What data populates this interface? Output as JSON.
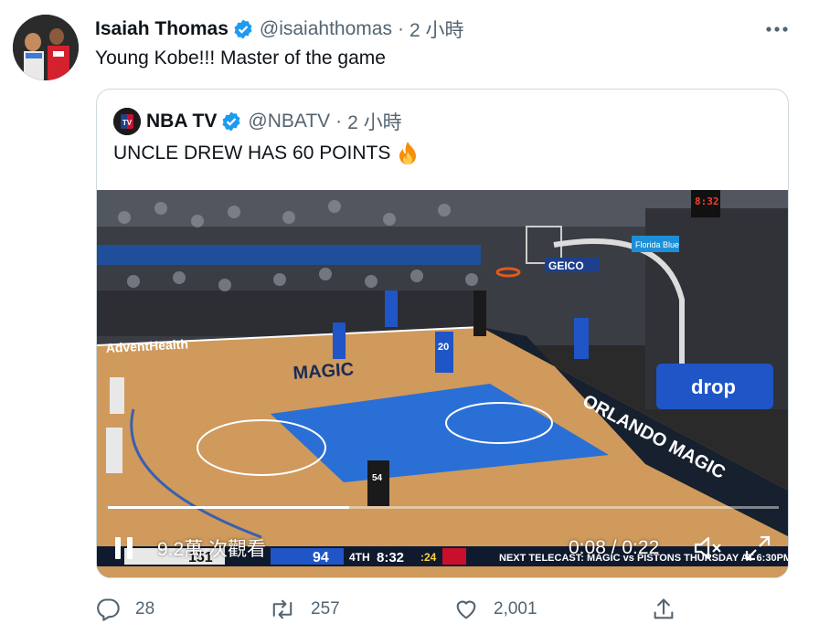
{
  "tweet": {
    "author_name": "Isaiah Thomas",
    "author_handle": "@isaiahthomas",
    "separator": "·",
    "time": "2 小時",
    "text": "Young Kobe!!! Master of the game"
  },
  "quoted": {
    "author_name": "NBA TV",
    "author_handle": "@NBATV",
    "separator": "·",
    "time": "2 小時",
    "text": "UNCLE DREW HAS 60 POINTS",
    "video": {
      "views": "9.2萬 次觀看",
      "timestamp": "0:08 / 0:22",
      "progress": 0.36,
      "scoreboard": {
        "away_score": "151",
        "home_score": "94",
        "quarter": "4TH",
        "clock": "8:32",
        "shot_clock": ":24",
        "ticker": "NEXT TELECAST: MAGIC vs PISTONS  THURSDAY AT 6:30PM"
      },
      "arena_text": {
        "baseline": "ORLANDO MAGIC",
        "sideline": "AdventHealth",
        "floor_logo": "MAGIC",
        "sponsor": "GEICO",
        "sign": "Florida Blue",
        "stanchion": "drop",
        "shot_clock_board": "8:32",
        "jersey_a": "20",
        "jersey_b": "54"
      }
    }
  },
  "actions": {
    "reply_count": "28",
    "retweet_count": "257",
    "like_count": "2,001"
  },
  "colors": {
    "verified": "#1d9bf0",
    "text_secondary": "#536471",
    "border": "#cfd9de"
  }
}
